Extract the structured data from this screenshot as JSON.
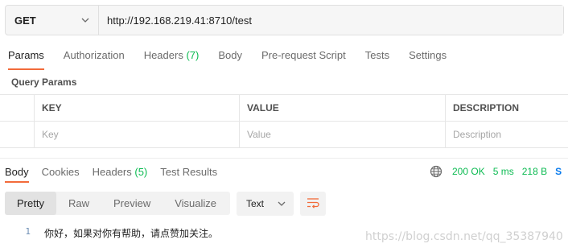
{
  "request": {
    "method": "GET",
    "url": "http://192.168.219.41:8710/test"
  },
  "request_tabs": [
    {
      "label": "Params",
      "count": ""
    },
    {
      "label": "Authorization",
      "count": ""
    },
    {
      "label": "Headers",
      "count": "(7)"
    },
    {
      "label": "Body",
      "count": ""
    },
    {
      "label": "Pre-request Script",
      "count": ""
    },
    {
      "label": "Tests",
      "count": ""
    },
    {
      "label": "Settings",
      "count": ""
    }
  ],
  "query_params": {
    "title": "Query Params",
    "headers": {
      "key": "KEY",
      "value": "VALUE",
      "description": "DESCRIPTION"
    },
    "placeholders": {
      "key": "Key",
      "value": "Value",
      "description": "Description"
    }
  },
  "response_tabs": [
    {
      "label": "Body",
      "count": ""
    },
    {
      "label": "Cookies",
      "count": ""
    },
    {
      "label": "Headers",
      "count": "(5)"
    },
    {
      "label": "Test Results",
      "count": ""
    }
  ],
  "response_status": {
    "status": "200 OK",
    "time": "5 ms",
    "size": "218 B",
    "save": "S"
  },
  "format": {
    "modes": [
      "Pretty",
      "Raw",
      "Preview",
      "Visualize"
    ],
    "language": "Text"
  },
  "body_lines": [
    {
      "number": "1",
      "text": "你好，如果对你有帮助，请点赞加关注。"
    }
  ],
  "watermark": "https://blog.csdn.net/qq_35387940",
  "colors": {
    "accent": "#f26b3a",
    "success": "#0cbb52",
    "link": "#097bed"
  }
}
